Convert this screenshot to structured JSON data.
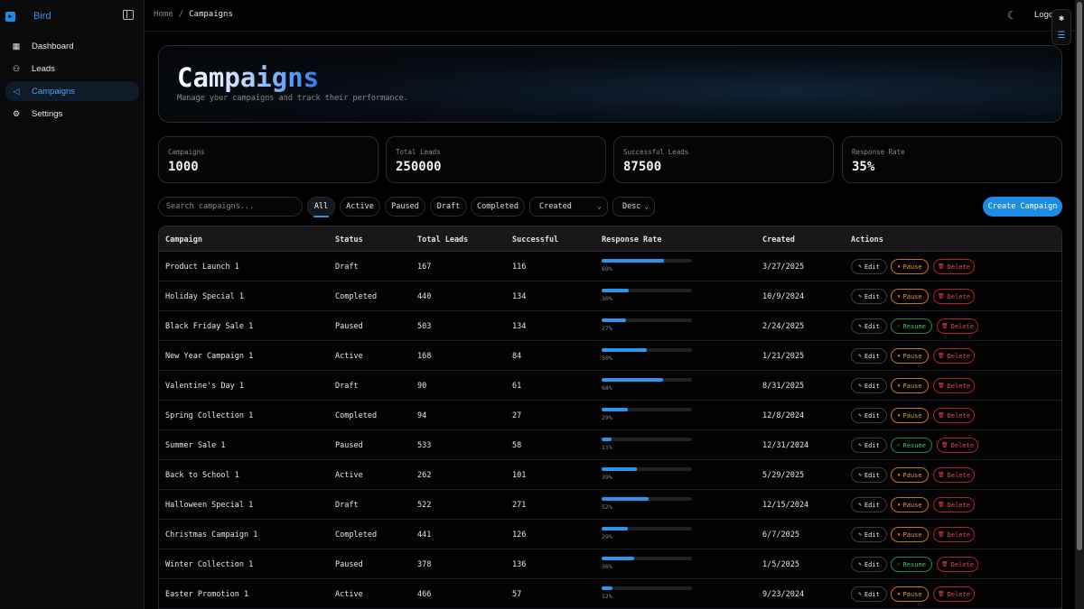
{
  "sidebar": {
    "brand": "Bird",
    "items": [
      {
        "label": "Dashboard",
        "icon": "grid-icon"
      },
      {
        "label": "Leads",
        "icon": "users-icon"
      },
      {
        "label": "Campaigns",
        "icon": "megaphone-icon",
        "active": true
      },
      {
        "label": "Settings",
        "icon": "gear-icon"
      }
    ]
  },
  "topbar": {
    "breadcrumb_home": "Home",
    "breadcrumb_sep": "/",
    "breadcrumb_current": "Campaigns",
    "logout": "Logo"
  },
  "hero": {
    "title": "Campaigns",
    "subtitle": "Manage your campaigns and track their performance."
  },
  "stats": [
    {
      "label": "Campaigns",
      "value": "1000"
    },
    {
      "label": "Total Leads",
      "value": "250000"
    },
    {
      "label": "Successful Leads",
      "value": "87500"
    },
    {
      "label": "Response Rate",
      "value": "35%"
    }
  ],
  "filters": {
    "search_placeholder": "Search campaigns...",
    "chips": [
      "All",
      "Active",
      "Paused",
      "Draft",
      "Completed"
    ],
    "active_chip": "All",
    "sort_field": "Created",
    "sort_order": "Desc",
    "create_label": "Create Campaign"
  },
  "table": {
    "columns": [
      "Campaign",
      "Status",
      "Total Leads",
      "Successful",
      "Response Rate",
      "Created",
      "Actions"
    ],
    "actions": {
      "edit": "Edit",
      "pause": "Pause",
      "resume": "Resume",
      "delete": "Delete"
    },
    "rows": [
      {
        "name": "Product Launch 1",
        "status": "Draft",
        "leads": "167",
        "successful": "116",
        "rate": 69,
        "rate_label": "69%",
        "created": "3/27/2025"
      },
      {
        "name": "Holiday Special 1",
        "status": "Completed",
        "leads": "440",
        "successful": "134",
        "rate": 30,
        "rate_label": "30%",
        "created": "10/9/2024"
      },
      {
        "name": "Black Friday Sale 1",
        "status": "Paused",
        "leads": "503",
        "successful": "134",
        "rate": 27,
        "rate_label": "27%",
        "created": "2/24/2025"
      },
      {
        "name": "New Year Campaign 1",
        "status": "Active",
        "leads": "168",
        "successful": "84",
        "rate": 50,
        "rate_label": "50%",
        "created": "1/21/2025"
      },
      {
        "name": "Valentine's Day 1",
        "status": "Draft",
        "leads": "90",
        "successful": "61",
        "rate": 68,
        "rate_label": "68%",
        "created": "8/31/2025"
      },
      {
        "name": "Spring Collection 1",
        "status": "Completed",
        "leads": "94",
        "successful": "27",
        "rate": 29,
        "rate_label": "29%",
        "created": "12/8/2024"
      },
      {
        "name": "Summer Sale 1",
        "status": "Paused",
        "leads": "533",
        "successful": "58",
        "rate": 11,
        "rate_label": "11%",
        "created": "12/31/2024"
      },
      {
        "name": "Back to School 1",
        "status": "Active",
        "leads": "262",
        "successful": "101",
        "rate": 39,
        "rate_label": "39%",
        "created": "5/29/2025"
      },
      {
        "name": "Halloween Special 1",
        "status": "Draft",
        "leads": "522",
        "successful": "271",
        "rate": 52,
        "rate_label": "52%",
        "created": "12/15/2024"
      },
      {
        "name": "Christmas Campaign 1",
        "status": "Completed",
        "leads": "441",
        "successful": "126",
        "rate": 29,
        "rate_label": "29%",
        "created": "6/7/2025"
      },
      {
        "name": "Winter Collection 1",
        "status": "Paused",
        "leads": "378",
        "successful": "136",
        "rate": 36,
        "rate_label": "36%",
        "created": "1/5/2025"
      },
      {
        "name": "Easter Promotion 1",
        "status": "Active",
        "leads": "466",
        "successful": "57",
        "rate": 12,
        "rate_label": "12%",
        "created": "9/23/2024"
      }
    ]
  },
  "colors": {
    "accent": "#1d8ce6",
    "pause": "#e6953c",
    "resume": "#34c465",
    "delete": "#ec4350"
  }
}
